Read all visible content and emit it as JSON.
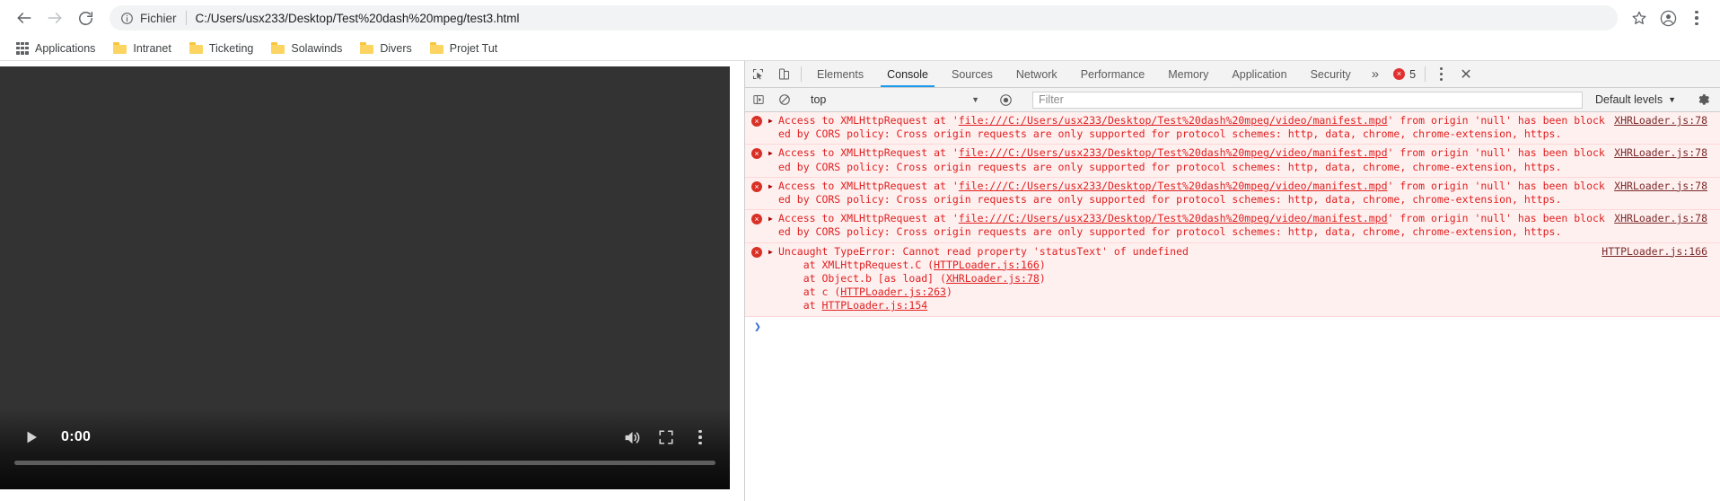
{
  "browser": {
    "nav": {
      "back_label": "Back",
      "forward_label": "Forward",
      "reload_label": "Reload"
    },
    "omnibox": {
      "scheme_label": "Fichier",
      "url": "C:/Users/usx233/Desktop/Test%20dash%20mpeg/test3.html",
      "info_icon": "info-circle-icon",
      "star_icon": "bookmark-star-icon",
      "profile_icon": "profile-avatar-icon",
      "menu_icon": "chrome-menu-icon"
    },
    "bookmarks": [
      {
        "label": "Applications",
        "icon": "apps-grid-icon"
      },
      {
        "label": "Intranet",
        "icon": "folder-icon"
      },
      {
        "label": "Ticketing",
        "icon": "folder-icon"
      },
      {
        "label": "Solawinds",
        "icon": "folder-icon"
      },
      {
        "label": "Divers",
        "icon": "folder-icon"
      },
      {
        "label": "Projet Tut",
        "icon": "folder-icon"
      }
    ]
  },
  "video": {
    "play_label": "Play",
    "current_time": "0:00",
    "mute_icon": "volume-speaker-icon",
    "fullscreen_icon": "fullscreen-icon",
    "options_icon": "kebab-menu-icon",
    "progress_percent": 0,
    "background_color": "#333333"
  },
  "devtools": {
    "inspect_icon": "inspect-element-icon",
    "device_icon": "device-toolbar-icon",
    "tabs": [
      {
        "label": "Elements",
        "active": false
      },
      {
        "label": "Console",
        "active": true
      },
      {
        "label": "Sources",
        "active": false
      },
      {
        "label": "Network",
        "active": false
      },
      {
        "label": "Performance",
        "active": false
      },
      {
        "label": "Memory",
        "active": false
      },
      {
        "label": "Application",
        "active": false
      },
      {
        "label": "Security",
        "active": false
      }
    ],
    "more_tabs_label": "»",
    "error_count": "5",
    "error_badge_glyph": "×",
    "settings_kebab_icon": "devtools-menu-icon",
    "close_label": "✕",
    "toolbar": {
      "execute_icon": "console-sidebar-icon",
      "clear_icon": "clear-console-icon",
      "context_value": "top",
      "context_caret": "▼",
      "eye_icon": "live-expression-icon",
      "filter_placeholder": "Filter",
      "filter_value": "",
      "levels_value": "Default levels",
      "levels_caret": "▼",
      "gear_icon": "settings-gear-icon"
    },
    "accent_color": "#1a9bf0",
    "error_color": "#e02020",
    "messages": [
      {
        "type": "error",
        "expandable": true,
        "link_text": "file:///C:/Users/usx233/Desktop/Test%20dash%20mpeg/video/manifest.mpd",
        "text_before": "Access to XMLHttpRequest at '",
        "text_after": "' from origin 'null' has been blocked by CORS policy: Cross origin requests are only supported for protocol schemes: http, data, chrome, chrome-extension, https.",
        "source": "XHRLoader.js:78"
      },
      {
        "type": "error",
        "expandable": true,
        "link_text": "file:///C:/Users/usx233/Desktop/Test%20dash%20mpeg/video/manifest.mpd",
        "text_before": "Access to XMLHttpRequest at '",
        "text_after": "' from origin 'null' has been blocked by CORS policy: Cross origin requests are only supported for protocol schemes: http, data, chrome, chrome-extension, https.",
        "source": "XHRLoader.js:78"
      },
      {
        "type": "error",
        "expandable": true,
        "link_text": "file:///C:/Users/usx233/Desktop/Test%20dash%20mpeg/video/manifest.mpd",
        "text_before": "Access to XMLHttpRequest at '",
        "text_after": "' from origin 'null' has been blocked by CORS policy: Cross origin requests are only supported for protocol schemes: http, data, chrome, chrome-extension, https.",
        "source": "XHRLoader.js:78"
      },
      {
        "type": "error",
        "expandable": true,
        "link_text": "file:///C:/Users/usx233/Desktop/Test%20dash%20mpeg/video/manifest.mpd",
        "text_before": "Access to XMLHttpRequest at '",
        "text_after": "' from origin 'null' has been blocked by CORS policy: Cross origin requests are only supported for protocol schemes: http, data, chrome, chrome-extension, https.",
        "source": "XHRLoader.js:78"
      }
    ],
    "exception": {
      "type": "error",
      "expandable": true,
      "headline": "Uncaught TypeError: Cannot read property 'statusText' of undefined",
      "source": "HTTPLoader.js:166",
      "stack": [
        {
          "prefix": "    at XMLHttpRequest.C (",
          "link": "HTTPLoader.js:166",
          "suffix": ")"
        },
        {
          "prefix": "    at Object.b [as load] (",
          "link": "XHRLoader.js:78",
          "suffix": ")"
        },
        {
          "prefix": "    at c (",
          "link": "HTTPLoader.js:263",
          "suffix": ")"
        },
        {
          "prefix": "    at ",
          "link": "HTTPLoader.js:154",
          "suffix": ""
        }
      ]
    },
    "prompt_caret": "❯"
  }
}
